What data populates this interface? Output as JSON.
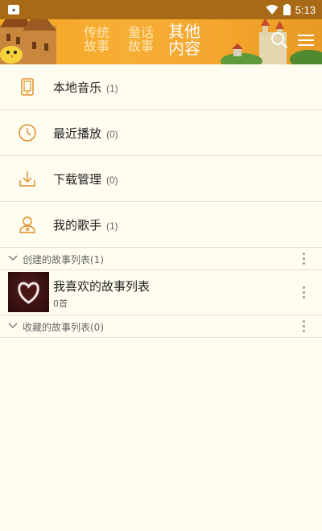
{
  "status_bar": {
    "time": "5:13",
    "notification_icon": "app-notification-icon",
    "icons": [
      "wifi-icon",
      "battery-icon"
    ]
  },
  "header": {
    "tabs": [
      {
        "line1": "传统",
        "line2": "故事",
        "active": false
      },
      {
        "line1": "童话",
        "line2": "故事",
        "active": false
      },
      {
        "line1": "其他",
        "line2": "内容",
        "active": true
      }
    ],
    "icons": [
      "search-icon",
      "menu-icon"
    ]
  },
  "menu": [
    {
      "label": "本地音乐",
      "count": "(1)",
      "icon": "phone-icon"
    },
    {
      "label": "最近播放",
      "count": "(0)",
      "icon": "clock-icon"
    },
    {
      "label": "下载管理",
      "count": "(0)",
      "icon": "download-icon"
    },
    {
      "label": "我的歌手",
      "count": "(1)",
      "icon": "singer-icon"
    }
  ],
  "sections": {
    "created": {
      "label": "创建的故事列表(1)"
    },
    "collected": {
      "label": "收藏的故事列表(0)"
    }
  },
  "playlist": {
    "title": "我喜欢的故事列表",
    "subtitle": "0首"
  },
  "colors": {
    "accent": "#f5a623",
    "status_bar": "#a86a16",
    "icon_orange": "#e0902a",
    "background": "#fffdf0"
  }
}
